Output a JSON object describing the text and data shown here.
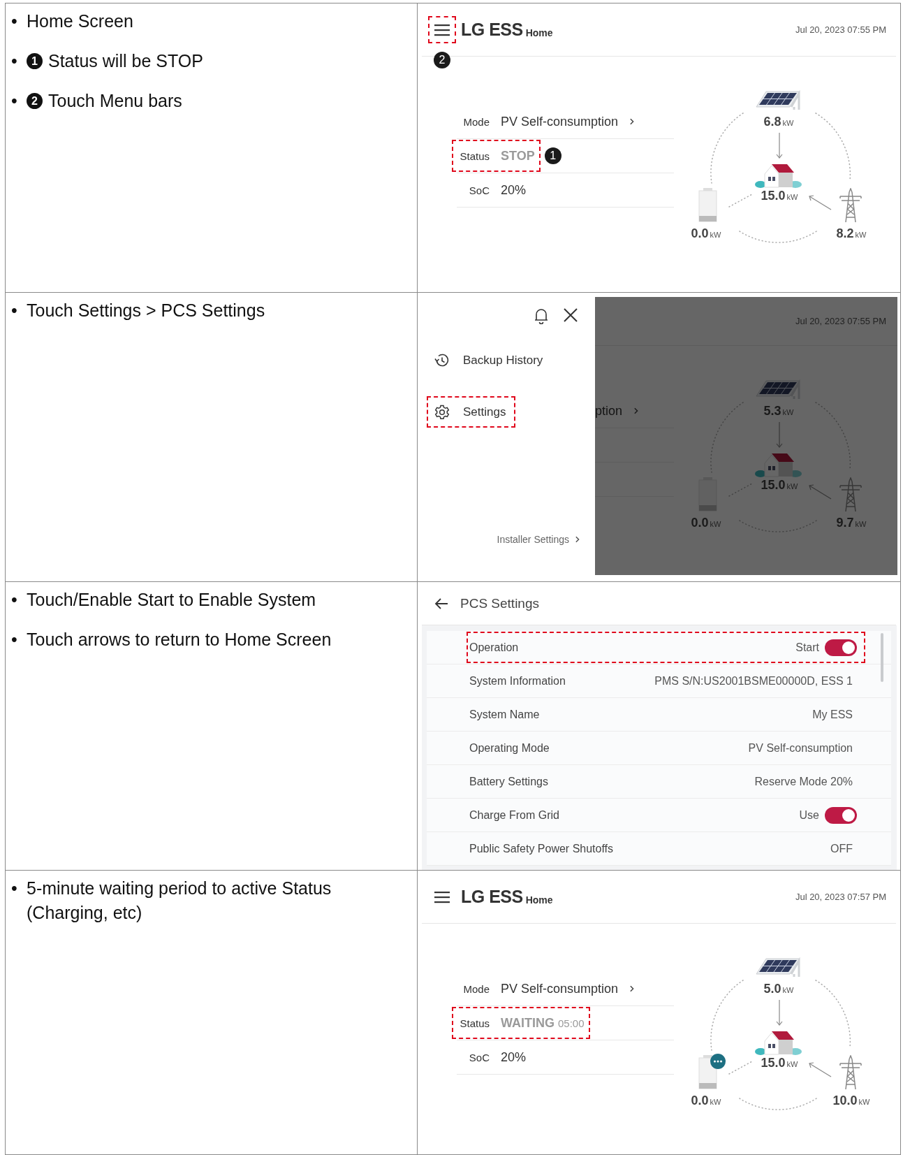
{
  "steps": [
    {
      "notes": [
        {
          "bullet": "•",
          "text": "Home Screen"
        },
        {
          "bullet": "•",
          "callout": "1",
          "text": "Status will be STOP"
        },
        {
          "bullet": "•",
          "callout": "2",
          "text": "Touch Menu bars"
        }
      ],
      "screen": {
        "kind": "home",
        "menu_highlighted": true,
        "menu_callout": "2",
        "logo": "LG ESS",
        "logo_sub": "Home",
        "datetime": "Jul 20, 2023 07:55 PM",
        "rows": [
          {
            "label": "Mode",
            "value": "PV Self-consumption",
            "kind": "plain",
            "link": true,
            "highlighted": false
          },
          {
            "label": "Status",
            "value": "STOP",
            "kind": "status",
            "highlighted": true,
            "callout": "1"
          },
          {
            "label": "SoC",
            "value": "20%",
            "kind": "plain",
            "highlighted": false
          }
        ],
        "flow": [
          {
            "kind": "solar",
            "value": "6.8",
            "unit": "kW"
          },
          {
            "kind": "home",
            "value": "15.0",
            "unit": "kW"
          },
          {
            "kind": "battery",
            "value": "0.0",
            "unit": "kW"
          },
          {
            "kind": "grid",
            "value": "8.2",
            "unit": "kW"
          }
        ]
      }
    },
    {
      "notes": [
        {
          "bullet": "•",
          "text": "Touch Settings > PCS Settings"
        }
      ],
      "screen": {
        "kind": "menu",
        "items": [
          {
            "kind": "history",
            "label": "Backup History",
            "highlighted": false
          },
          {
            "kind": "settings",
            "label": "Settings",
            "highlighted": true
          }
        ],
        "installer_link": "Installer Settings",
        "background": {
          "datetime": "Jul 20, 2023 07:55 PM",
          "mode_fragment": "ption",
          "flow": [
            {
              "kind": "solar",
              "value": "5.3",
              "unit": "kW"
            },
            {
              "kind": "home",
              "value": "15.0",
              "unit": "kW"
            },
            {
              "kind": "battery",
              "value": "0.0",
              "unit": "kW"
            },
            {
              "kind": "grid",
              "value": "9.7",
              "unit": "kW"
            }
          ]
        }
      }
    },
    {
      "notes": [
        {
          "bullet": "•",
          "text": "Touch/Enable Start to Enable System"
        },
        {
          "bullet": "•",
          "text": "Touch arrows to return to Home Screen"
        }
      ],
      "screen": {
        "kind": "settings",
        "title": "PCS Settings",
        "rows": [
          {
            "label": "Operation",
            "value": "Start",
            "kind": "toggle",
            "on": true,
            "highlighted": true
          },
          {
            "label": "System Information",
            "value": "PMS S/N:US2001BSME00000D, ESS 1",
            "kind": "text",
            "highlighted": false
          },
          {
            "label": "System Name",
            "value": "My ESS",
            "kind": "text",
            "highlighted": false
          },
          {
            "label": "Operating Mode",
            "value": "PV Self-consumption",
            "kind": "text",
            "highlighted": false
          },
          {
            "label": "Battery Settings",
            "value": "Reserve Mode 20%",
            "kind": "text",
            "highlighted": false
          },
          {
            "label": "Charge From Grid",
            "value": "Use",
            "kind": "toggle",
            "on": true,
            "highlighted": false
          },
          {
            "label": "Public Safety Power Shutoffs",
            "value": "OFF",
            "kind": "text",
            "highlighted": false
          }
        ]
      }
    },
    {
      "notes": [
        {
          "bullet": "•",
          "text": "5-minute waiting period to active Status (Charging, etc)"
        }
      ],
      "screen": {
        "kind": "home",
        "menu_highlighted": false,
        "logo": "LG ESS",
        "logo_sub": "Home",
        "datetime": "Jul 20, 2023 07:57 PM",
        "rows": [
          {
            "label": "Mode",
            "value": "PV Self-consumption",
            "kind": "plain",
            "link": true,
            "highlighted": false
          },
          {
            "label": "Status",
            "value": "WAITING",
            "timer": "05:00",
            "kind": "status",
            "highlighted": true
          },
          {
            "label": "SoC",
            "value": "20%",
            "kind": "plain",
            "highlighted": false
          }
        ],
        "flow": [
          {
            "kind": "solar",
            "value": "5.0",
            "unit": "kW"
          },
          {
            "kind": "home",
            "value": "15.0",
            "unit": "kW"
          },
          {
            "kind": "battery",
            "value": "0.0",
            "unit": "kW",
            "badge": true
          },
          {
            "kind": "grid",
            "value": "10.0",
            "unit": "kW"
          }
        ]
      }
    }
  ]
}
